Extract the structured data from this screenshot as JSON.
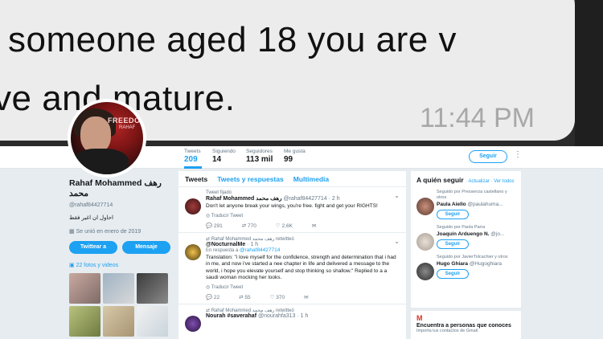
{
  "message": {
    "line1": "someone aged 18 you are v",
    "line2": "ve and mature.",
    "time": "11:44 PM"
  },
  "avatar": {
    "logo_text": "FREEDOM",
    "logo_sub": "RAHAF"
  },
  "profile_nav": {
    "stats": [
      {
        "label": "Tweets",
        "value": "209"
      },
      {
        "label": "Siguiendo",
        "value": "14"
      },
      {
        "label": "Seguidores",
        "value": "113 mil"
      },
      {
        "label": "Me gusta",
        "value": "99"
      }
    ],
    "follow_label": "Seguir",
    "more": "⋮"
  },
  "profile": {
    "name": "Rahaf Mohammed رهف محمد",
    "handle": "@rahaf84427714",
    "bio": "احاول ان اغير فقط",
    "joined": "Se unió en enero de 2019",
    "tweet_to_label": "Twittear a",
    "message_label": "Mensaje",
    "photos_label": "22 fotos y videos"
  },
  "timeline": {
    "tabs": [
      "Tweets",
      "Tweets y respuestas",
      "Multimedia"
    ],
    "tweets": [
      {
        "context": "Tweet fijado",
        "name": "Rahaf Mohammed رهف محمد",
        "meta": "@rahaf84427714 · 2 h",
        "text": "Don't let anyone break your wings, you're free. fight and get your RIGHTS!",
        "translate": "Traducir Tweet",
        "counts": [
          "291",
          "770",
          "2,6K"
        ]
      },
      {
        "context": "Rahaf Mohammed رهف محمد retwitteó",
        "name": "@NocturnalMe",
        "meta": "· 1 h",
        "reply_prefix": "En respuesta a",
        "reply_to": "@rahaf84427714",
        "text": "Translation: \"i love myself for the confidence, strength and determination that i had in me, and now i've started a nee chapter in life and delivered a message to the world, i hope you elevate yourself and stop thinking so shallow.\" Replied to a a saudi woman mocking her looks.",
        "translate": "Traducir Tweet",
        "counts": [
          "22",
          "55",
          "370"
        ]
      },
      {
        "context": "Rahaf Mohammed رهف محمد retwitteó",
        "name": "Nourah #saverahaf",
        "meta": "@nourahfa313 · 1 h"
      }
    ]
  },
  "who_to_follow": {
    "title": "A quién seguir",
    "links": "· Actualizar · Ver todos",
    "items": [
      {
        "context": "Seguido por Pressenza castellano y otros",
        "name": "Paula Aiello",
        "handle": "@paulahuma...",
        "button": "Seguir"
      },
      {
        "context": "Seguido por Paola Parra",
        "name": "Joaquín Arduengo N.",
        "handle": "@jo...",
        "button": "Seguir"
      },
      {
        "context": "Seguido por JavierTolcachier y otros",
        "name": "Hugo Ghiara",
        "handle": "@Hugoghiara",
        "button": "Seguir"
      }
    ]
  },
  "contacts": {
    "icon": "M",
    "title": "Encuentra a personas que conoces",
    "sub": "Importa tus contactos de Gmail"
  }
}
